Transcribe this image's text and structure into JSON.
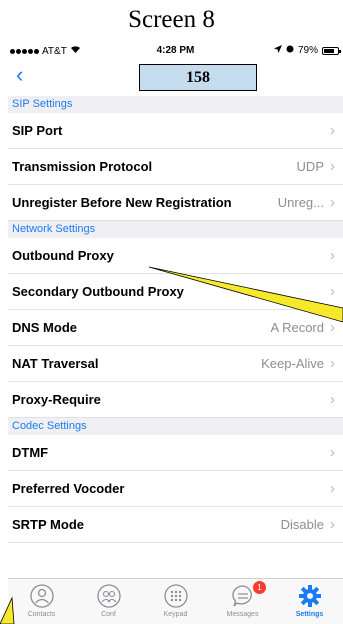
{
  "screen_title": "Screen 8",
  "status_bar": {
    "carrier": "AT&T",
    "time": "4:28 PM",
    "battery": "79%",
    "battery_level": 0.79
  },
  "nav": {
    "back_icon": "chevron-left-icon",
    "box_label": "158"
  },
  "sections": [
    {
      "header": "SIP Settings",
      "rows": [
        {
          "label": "SIP Port",
          "value": ""
        },
        {
          "label": "Transmission Protocol",
          "value": "UDP"
        },
        {
          "label": "Unregister Before New Registration",
          "value": "Unreg..."
        }
      ]
    },
    {
      "header": "Network Settings",
      "rows": [
        {
          "label": "Outbound Proxy",
          "value": ""
        },
        {
          "label": "Secondary Outbound Proxy",
          "value": ""
        },
        {
          "label": "DNS Mode",
          "value": "A Record"
        },
        {
          "label": "NAT Traversal",
          "value": "Keep-Alive"
        },
        {
          "label": "Proxy-Require",
          "value": ""
        }
      ]
    },
    {
      "header": "Codec Settings",
      "rows": [
        {
          "label": "DTMF",
          "value": ""
        },
        {
          "label": "Preferred Vocoder",
          "value": ""
        },
        {
          "label": "SRTP Mode",
          "value": "Disable"
        }
      ]
    }
  ],
  "tabs": [
    {
      "label": "Contacts",
      "icon": "contacts-icon"
    },
    {
      "label": "Conf",
      "icon": "conference-icon"
    },
    {
      "label": "Keypad",
      "icon": "keypad-icon"
    },
    {
      "label": "Messages",
      "icon": "messages-icon",
      "badge": "1"
    },
    {
      "label": "Settings",
      "icon": "settings-gear-icon",
      "active": true
    }
  ],
  "colors": {
    "accent": "#1a7cf5",
    "header_bg": "#efeff4",
    "nav_box": "#c5dcef",
    "annotation": "#f5e92a",
    "badge": "#ff3b30"
  }
}
